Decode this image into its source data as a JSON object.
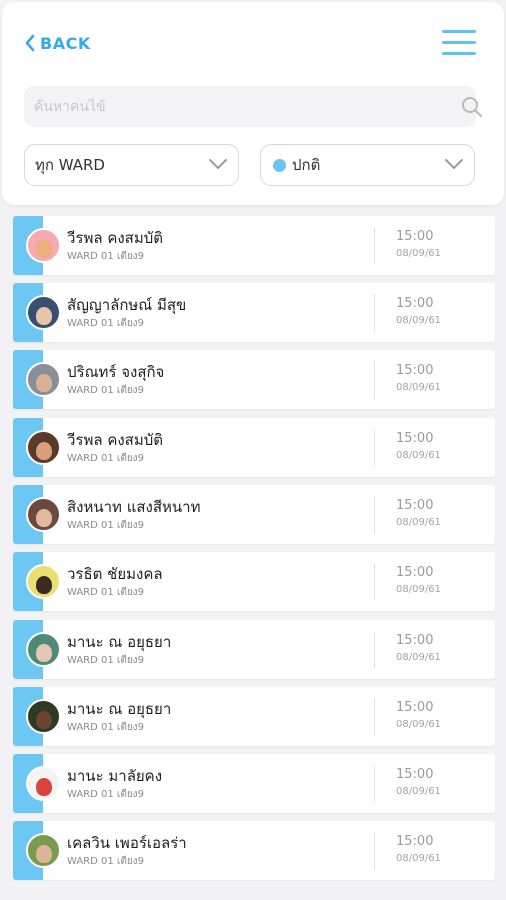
{
  "header": {
    "back_label": "BACK",
    "search_placeholder": "ค้นหาคนไข้",
    "ward_filter": "ทุก WARD",
    "status_filter": "ปกติ",
    "accent_color": "#35a9ec",
    "status_dot_color": "#66c5f3"
  },
  "patients": [
    {
      "name": "วีรพล คงสมบัติ",
      "ward": "WARD 01 เตียง9",
      "time": "15:00",
      "date": "08/09/61"
    },
    {
      "name": "สัญญาลักษณ์ มีสุข",
      "ward": "WARD 01 เตียง9",
      "time": "15:00",
      "date": "08/09/61"
    },
    {
      "name": "ปริณทร์ จงสุกิจ",
      "ward": "WARD 01 เตียง9",
      "time": "15:00",
      "date": "08/09/61"
    },
    {
      "name": "วีรพล คงสมบัติ",
      "ward": "WARD 01 เตียง9",
      "time": "15:00",
      "date": "08/09/61"
    },
    {
      "name": "สิงหนาท แสงสีหนาท",
      "ward": "WARD 01 เตียง9",
      "time": "15:00",
      "date": "08/09/61"
    },
    {
      "name": "วรธิต ชัยมงคล",
      "ward": "WARD 01 เตียง9",
      "time": "15:00",
      "date": "08/09/61"
    },
    {
      "name": "มานะ ณ อยุธยา",
      "ward": "WARD 01 เตียง9",
      "time": "15:00",
      "date": "08/09/61"
    },
    {
      "name": "มานะ ณ อยุธยา",
      "ward": "WARD 01 เตียง9",
      "time": "15:00",
      "date": "08/09/61"
    },
    {
      "name": "มานะ มาลัยคง",
      "ward": "WARD 01 เตียง9",
      "time": "15:00",
      "date": "08/09/61"
    },
    {
      "name": "เคลวิน เพอร์เอลร่า",
      "ward": "WARD 01 เตียง9",
      "time": "15:00",
      "date": "08/09/61"
    }
  ],
  "icons": {
    "back": "chevron-left-icon",
    "menu": "hamburger-menu-icon",
    "search": "search-icon",
    "dropdown": "chevron-down-icon",
    "avatar": "patient-avatar-icon"
  }
}
